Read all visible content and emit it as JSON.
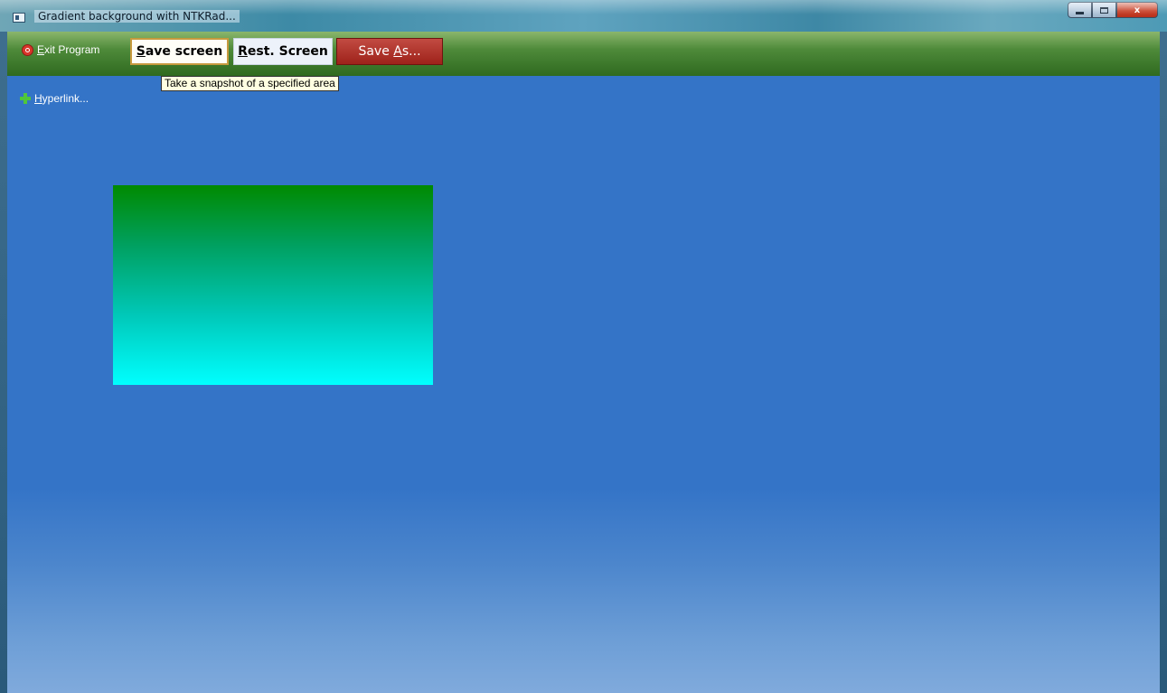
{
  "window": {
    "title": "Gradient background with NTKRad...",
    "controls": {
      "minimize": "",
      "maximize": "",
      "close": "x"
    }
  },
  "toolbar": {
    "exit_label_accel": "E",
    "exit_label_rest": "xit Program",
    "save_screen_accel": "S",
    "save_screen_rest": "ave screen",
    "rest_screen_accel": "R",
    "rest_screen_rest": "est. Screen",
    "save_as_pre": "Save ",
    "save_as_accel": "A",
    "save_as_rest": "s..."
  },
  "tooltip": {
    "text": "Take a snapshot of a specified area"
  },
  "hyperlink": {
    "accel": "H",
    "rest": "yperlink..."
  },
  "colors": {
    "client_background": "#3474c7",
    "toolbar_green": "#2f6a1f",
    "gradient_top": "#008a00",
    "gradient_bottom": "#00ffff",
    "save_as_red": "#b0322a"
  }
}
